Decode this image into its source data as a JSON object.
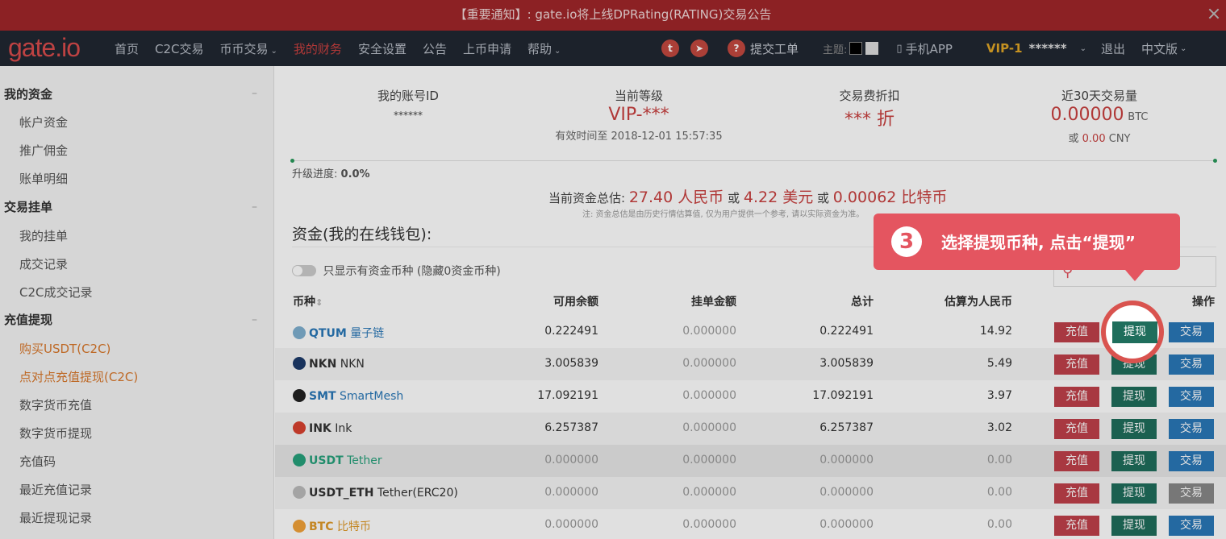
{
  "notice": {
    "text": "【重要通知】:  gate.io将上线DPRating(RATING)交易公告"
  },
  "brand": {
    "logo": "gate.io"
  },
  "nav": {
    "items": [
      "首页",
      "C2C交易",
      "币币交易",
      "我的财务",
      "安全设置",
      "公告",
      "上币申请",
      "帮助"
    ],
    "ticket": "提交工单",
    "theme_label": "主题:",
    "app": "手机APP",
    "vip": "VIP-1",
    "user": "******",
    "logout": "退出",
    "lang": "中文版"
  },
  "sidebar": {
    "sections": [
      {
        "title": "我的资金",
        "items": [
          "帐户资金",
          "推广佣金",
          "账单明细"
        ]
      },
      {
        "title": "交易挂单",
        "items": [
          "我的挂单",
          "成交记录",
          "C2C成交记录"
        ]
      },
      {
        "title": "充值提现",
        "items": [
          "购买USDT(C2C)",
          "点对点充值提现(C2C)",
          "数字货币充值",
          "数字货币提现",
          "充值码",
          "最近充值记录",
          "最近提现记录"
        ]
      }
    ]
  },
  "stats": {
    "account_id_label": "我的账号ID",
    "account_id": "******",
    "level_label": "当前等级",
    "level": "VIP-***",
    "valid_until": "有效时间至 2018-12-01 15:57:35",
    "discount_label": "交易费折扣",
    "discount": "*** 折",
    "volume_label": "近30天交易量",
    "volume_btc": "0.00000",
    "volume_unit": "BTC",
    "volume_cny_prefix": "或",
    "volume_cny": "0.00",
    "volume_cny_unit": "CNY"
  },
  "progress": {
    "label": "升级进度:",
    "value": "0.0%"
  },
  "total": {
    "label": "当前资金总估:",
    "cny": "27.40 人民币",
    "or1": "或",
    "usd": "4.22 美元",
    "or2": "或",
    "btc": "0.00062 比特币",
    "note": "注: 资金总估是由历史行情估算值, 仅为用户提供一个参考, 请以实际资金为准。"
  },
  "wallet": {
    "title": "资金(我的在线钱包):",
    "toggle": "只显示有资金币种 (隐藏0资金币种)"
  },
  "table": {
    "headers": [
      "币种",
      "可用余额",
      "挂单金额",
      "总计",
      "估算为人民币",
      "操作"
    ],
    "rows": [
      {
        "code": "QTUM",
        "name": "量子链",
        "available": "0.222491",
        "orders": "0.000000",
        "total": "0.222491",
        "cny": "14.92",
        "icon_color": "#7fb0d0",
        "link": true
      },
      {
        "code": "NKN",
        "name": "NKN",
        "available": "3.005839",
        "orders": "0.000000",
        "total": "3.005839",
        "cny": "5.49",
        "icon_color": "#1d3b6a",
        "link": false
      },
      {
        "code": "SMT",
        "name": "SmartMesh",
        "available": "17.092191",
        "orders": "0.000000",
        "total": "17.092191",
        "cny": "3.97",
        "icon_color": "#222222",
        "link": true
      },
      {
        "code": "INK",
        "name": "Ink",
        "available": "6.257387",
        "orders": "0.000000",
        "total": "6.257387",
        "cny": "3.02",
        "icon_color": "#d9412f",
        "link": false
      },
      {
        "code": "USDT",
        "name": "Tether",
        "available": "0.000000",
        "orders": "0.000000",
        "total": "0.000000",
        "cny": "0.00",
        "icon_color": "#26a17b",
        "link": true
      },
      {
        "code": "USDT_ETH",
        "name": "Tether(ERC20)",
        "available": "0.000000",
        "orders": "0.000000",
        "total": "0.000000",
        "cny": "0.00",
        "icon_color": "#bbbbbb",
        "link": false
      },
      {
        "code": "BTC",
        "name": "比特币",
        "available": "0.000000",
        "orders": "0.000000",
        "total": "0.000000",
        "cny": "0.00",
        "icon_color": "#f2a23a",
        "link": true
      }
    ],
    "btn_deposit": "充值",
    "btn_withdraw": "提现",
    "btn_trade": "交易"
  },
  "callout": {
    "number": "3",
    "text": "选择提现币种, 点击“提现”"
  }
}
